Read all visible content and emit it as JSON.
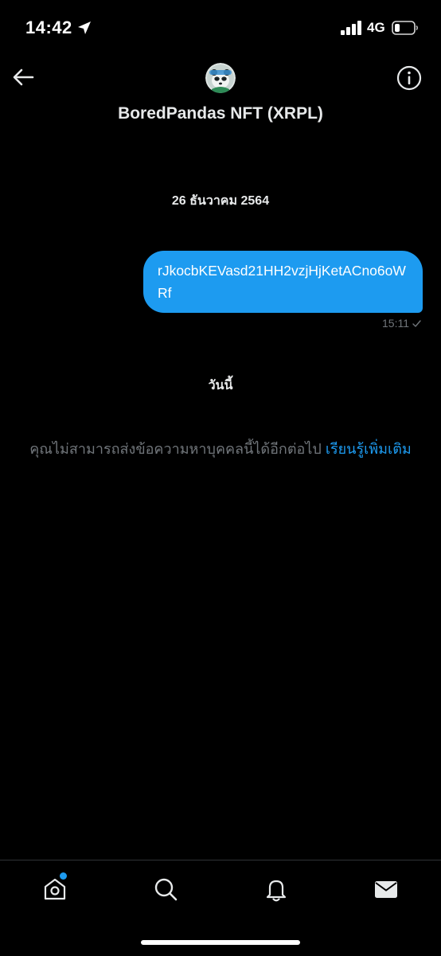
{
  "status_bar": {
    "time": "14:42",
    "network": "4G",
    "icons": [
      "location-arrow-icon",
      "cellular-signal-icon",
      "battery-icon"
    ]
  },
  "header": {
    "title": "BoredPandas NFT (XRPL)",
    "back_icon": "back-arrow-icon",
    "info_icon": "info-icon"
  },
  "conversation": {
    "date_separator": "26 ธันวาคม 2564",
    "messages": [
      {
        "text": "rJkocbKEVasd21HH2vzjHjKetACno6oWRf",
        "time": "15:11",
        "status_icon": "sent-check-icon",
        "direction": "outgoing"
      }
    ],
    "today_separator": "วันนี้",
    "notice": {
      "text": "คุณไม่สามารถส่งข้อความหาบุคคลนี้ได้อีกต่อไป ",
      "link": "เรียนรู้เพิ่มเติม"
    }
  },
  "tab_bar": {
    "items": [
      "home-icon",
      "search-icon",
      "notifications-icon",
      "messages-icon"
    ],
    "home_has_notification_dot": true
  },
  "colors": {
    "background": "#000000",
    "accent": "#1d9bf0",
    "secondary_text": "#71767b",
    "primary_text": "#e7e9ea"
  }
}
